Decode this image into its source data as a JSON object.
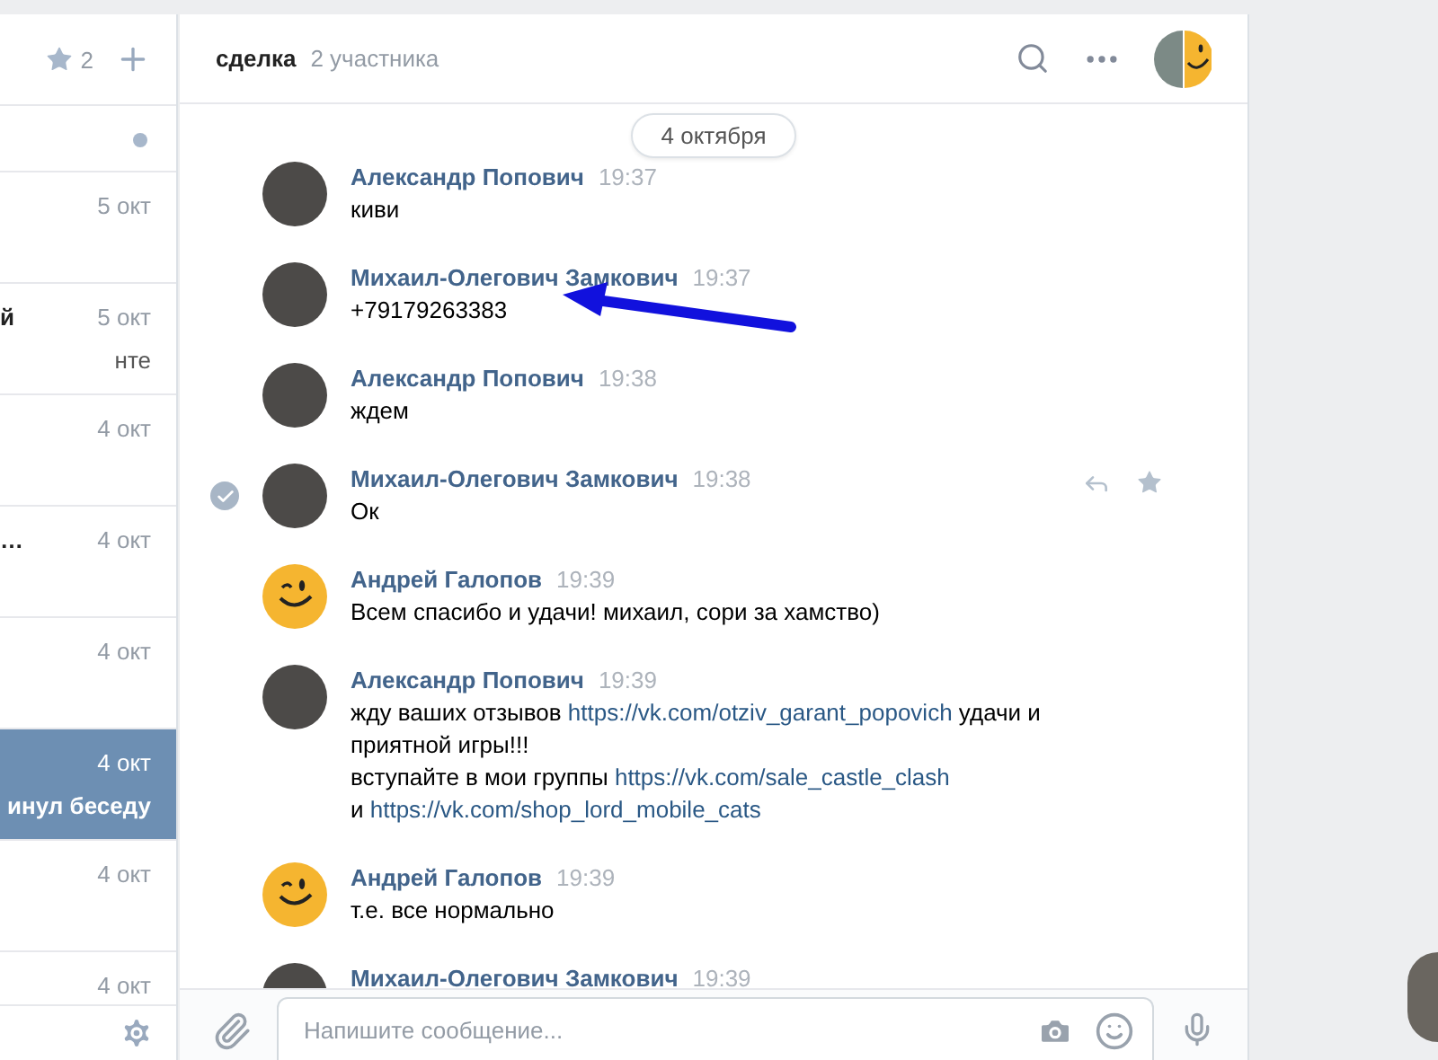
{
  "sidebar": {
    "favorites_count": "2",
    "rows": [
      {
        "kind": "pinned",
        "selected": false
      },
      {
        "kind": "dialog",
        "date": "5 окт",
        "selected": false
      },
      {
        "kind": "dialog",
        "date": "5 окт",
        "title": "й",
        "snippet": "нте",
        "selected": false
      },
      {
        "kind": "dialog",
        "date": "4 окт",
        "selected": false
      },
      {
        "kind": "dialog",
        "date": "4 окт",
        "title": "…",
        "selected": false
      },
      {
        "kind": "dialog",
        "date": "4 окт",
        "selected": false
      },
      {
        "kind": "dialog",
        "date": "4 окт",
        "snippet": "инул беседу",
        "selected": true
      },
      {
        "kind": "dialog",
        "date": "4 окт",
        "selected": false
      },
      {
        "kind": "dialog",
        "date": "4 окт",
        "selected": false
      }
    ]
  },
  "chat": {
    "title": "сделка",
    "members": "2 участника",
    "date_divider": "4 октября",
    "messages": [
      {
        "author": "Александр Попович",
        "time": "19:37",
        "kind": "photo",
        "selected": false,
        "lines": [
          [
            {
              "kind": "text",
              "text": "киви"
            }
          ]
        ]
      },
      {
        "author": "Михаил-Олегович Замкович",
        "time": "19:37",
        "kind": "photo",
        "selected": false,
        "lines": [
          [
            {
              "kind": "text",
              "text": "+79179263383"
            }
          ]
        ]
      },
      {
        "author": "Александр Попович",
        "time": "19:38",
        "kind": "photo",
        "selected": false,
        "lines": [
          [
            {
              "kind": "text",
              "text": "ждем"
            }
          ]
        ]
      },
      {
        "author": "Михаил-Олегович Замкович",
        "time": "19:38",
        "kind": "photo",
        "selected": true,
        "lines": [
          [
            {
              "kind": "text",
              "text": "Ок"
            }
          ]
        ]
      },
      {
        "author": "Андрей Галопов",
        "time": "19:39",
        "kind": "smiley",
        "selected": false,
        "lines": [
          [
            {
              "kind": "text",
              "text": "Всем спасибо и удачи! михаил, сори за хамство)"
            }
          ]
        ]
      },
      {
        "author": "Александр Попович",
        "time": "19:39",
        "kind": "photo",
        "selected": false,
        "lines": [
          [
            {
              "kind": "text",
              "text": "жду ваших отзывов "
            },
            {
              "kind": "link",
              "text": "https://vk.com/otziv_garant_popovich"
            },
            {
              "kind": "text",
              "text": " удачи и"
            }
          ],
          [
            {
              "kind": "text",
              "text": "приятной игры!!!"
            }
          ],
          [
            {
              "kind": "text",
              "text": "вступайте в мои группы "
            },
            {
              "kind": "link",
              "text": "https://vk.com/sale_castle_clash"
            }
          ],
          [
            {
              "kind": "text",
              "text": "и "
            },
            {
              "kind": "link",
              "text": "https://vk.com/shop_lord_mobile_cats"
            }
          ]
        ]
      },
      {
        "author": "Андрей Галопов",
        "time": "19:39",
        "kind": "smiley",
        "selected": false,
        "lines": [
          [
            {
              "kind": "text",
              "text": "т.е. все нормально"
            }
          ]
        ]
      },
      {
        "author": "Михаил-Олегович Замкович",
        "time": "19:39",
        "kind": "photo",
        "selected": false
      }
    ],
    "composer": {
      "placeholder": "Напишите сообщение..."
    }
  }
}
